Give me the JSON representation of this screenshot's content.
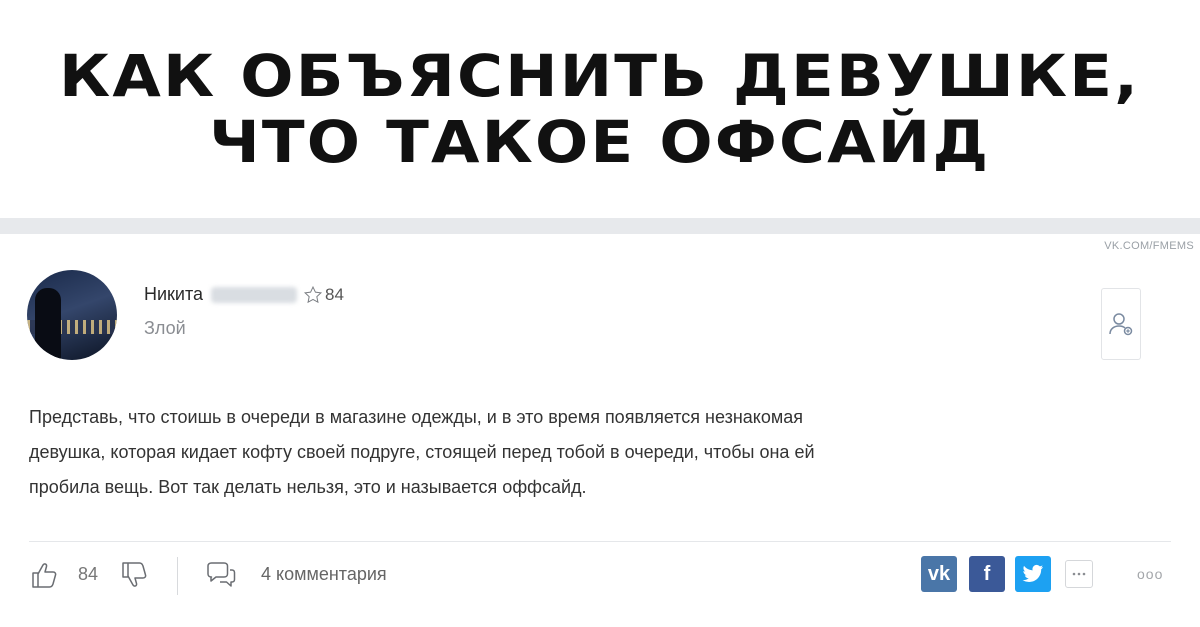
{
  "headline": {
    "line1": "КАК ОБЪЯСНИТЬ ДЕВУШКЕ,",
    "line2": "ЧТО ТАКОЕ ОФСАЙД"
  },
  "watermark": "VK.COM/FMEMS",
  "post": {
    "author_name": "Никита",
    "author_rating": "84",
    "author_status": "Злой",
    "text_lines": [
      "Представь, что стоишь в очереди в магазине одежды, и в это время появляется незнакомая",
      "девушка, которая кидает кофту своей подруге, стоящей перед тобой в очереди, чтобы она ей",
      "пробила вещь. Вот так делать нельзя, это и называется оффсайд."
    ]
  },
  "actions": {
    "likes": "84",
    "comments": "4 комментария",
    "share_vk": "vk",
    "share_fb": "f",
    "more_dots": "ооо"
  },
  "icons": {
    "star": "star-icon",
    "like": "thumbs-up-icon",
    "dislike": "thumbs-down-icon",
    "comment": "speech-bubbles-icon",
    "subscribe": "user-add-icon",
    "twitter": "twitter-bird-icon",
    "more": "ellipsis-icon"
  },
  "colors": {
    "vk": "#4a76a8",
    "facebook": "#3b5998",
    "twitter": "#1da1f2"
  }
}
